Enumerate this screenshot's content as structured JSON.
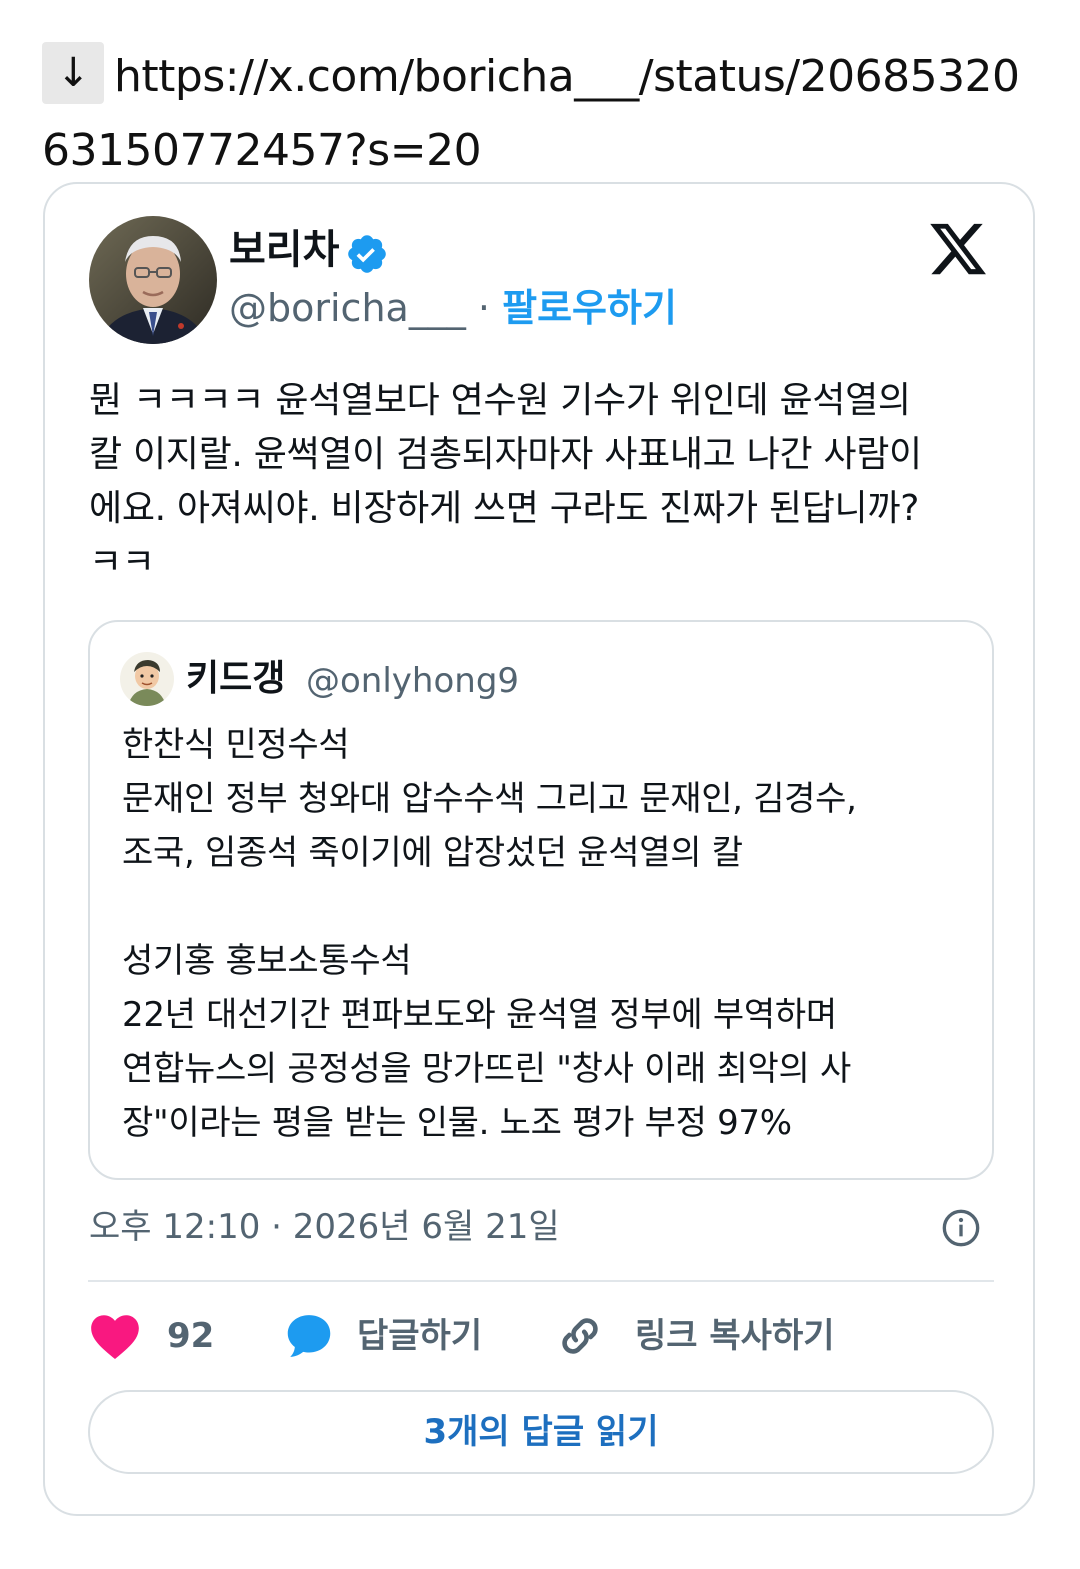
{
  "url": {
    "arrow": "↓",
    "text": "https://x.com/boricha___/status/2068532063150772457?s=20"
  },
  "tweet": {
    "display_name": "보리차",
    "verified_icon": "verified-badge-icon",
    "handle": "@boricha___",
    "separator": "·",
    "follow_label": "팔로우하기",
    "brand_icon": "x-logo-icon",
    "text": "뭔 ㅋㅋㅋㅋ 윤석열보다 연수원 기수가 위인데 윤석열의\n칼 이지랄. 윤썩열이 검총되자마자 사표내고 나간 사람이\n에요. 아져씨야. 비장하게 쓰면 구라도 진짜가 된답니까?\nㅋㅋ",
    "timestamp": "오후 12:10 · 2026년 6월 21일",
    "likes": "92",
    "reply_label": "답글하기",
    "copy_link_label": "링크 복사하기",
    "read_replies_label": "3개의 답글 읽기"
  },
  "quoted_tweet": {
    "display_name": "키드갱",
    "handle": "@onlyhong9",
    "text": "한찬식 민정수석\n문재인 정부 청와대 압수수색 그리고 문재인, 김경수,\n조국, 임종석 죽이기에 압장섰던 윤석열의 칼\n\n성기홍 홍보소통수석\n22년 대선기간 편파보도와 윤석열 정부에 부역하며\n연합뉴스의 공정성을 망가뜨린 \"창사 이래 최악의 사\n장\"이라는 평을 받는 인물. 노조 평가 부정 97%"
  },
  "colors": {
    "accent": "#1d9bf0",
    "like": "#f91880",
    "reply_icon": "#1d9bf0",
    "muted": "#536471",
    "border": "#d9dfe3"
  },
  "icons": {
    "heart": "heart-icon",
    "reply": "speech-bubble-icon",
    "link": "link-icon",
    "info": "info-icon",
    "download": "down-arrow-icon"
  }
}
